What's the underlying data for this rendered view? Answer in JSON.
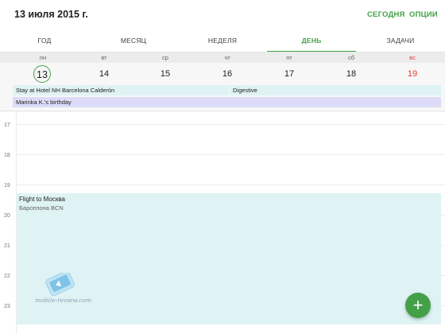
{
  "header": {
    "date_title": "13 июля 2015 г.",
    "today_button": "СЕГОДНЯ",
    "options_button": "ОПЦИИ"
  },
  "tabs": [
    {
      "label": "ГОД",
      "active": false
    },
    {
      "label": "МЕСЯЦ",
      "active": false
    },
    {
      "label": "НЕДЕЛЯ",
      "active": false
    },
    {
      "label": "ДЕНЬ",
      "active": true
    },
    {
      "label": "ЗАДАЧИ",
      "active": false
    }
  ],
  "week": {
    "days": [
      {
        "dow": "пн",
        "date": "13",
        "today": true
      },
      {
        "dow": "вт",
        "date": "14"
      },
      {
        "dow": "ср",
        "date": "15"
      },
      {
        "dow": "чт",
        "date": "16"
      },
      {
        "dow": "пт",
        "date": "17"
      },
      {
        "dow": "сб",
        "date": "18"
      },
      {
        "dow": "вс",
        "date": "19",
        "sunday": true
      }
    ]
  },
  "all_day_events": {
    "hotel": "Stay at Hotel NH Barcelona Calderón",
    "digestive": "Digestive",
    "birthday": "Marinka K.'s birthday"
  },
  "hours": [
    "17",
    "18",
    "19",
    "20",
    "21",
    "22",
    "23"
  ],
  "timed_event": {
    "title": "Flight to Москва",
    "subtitle": "Барселона BCN"
  },
  "watermark": {
    "text": "mobile-review.com"
  },
  "fab": {
    "icon": "plus-icon",
    "glyph": "+"
  },
  "colors": {
    "accent": "#43a047",
    "sunday": "#e53935",
    "event_teal": "#dff3f4",
    "event_lavender": "#dcdcf8"
  }
}
